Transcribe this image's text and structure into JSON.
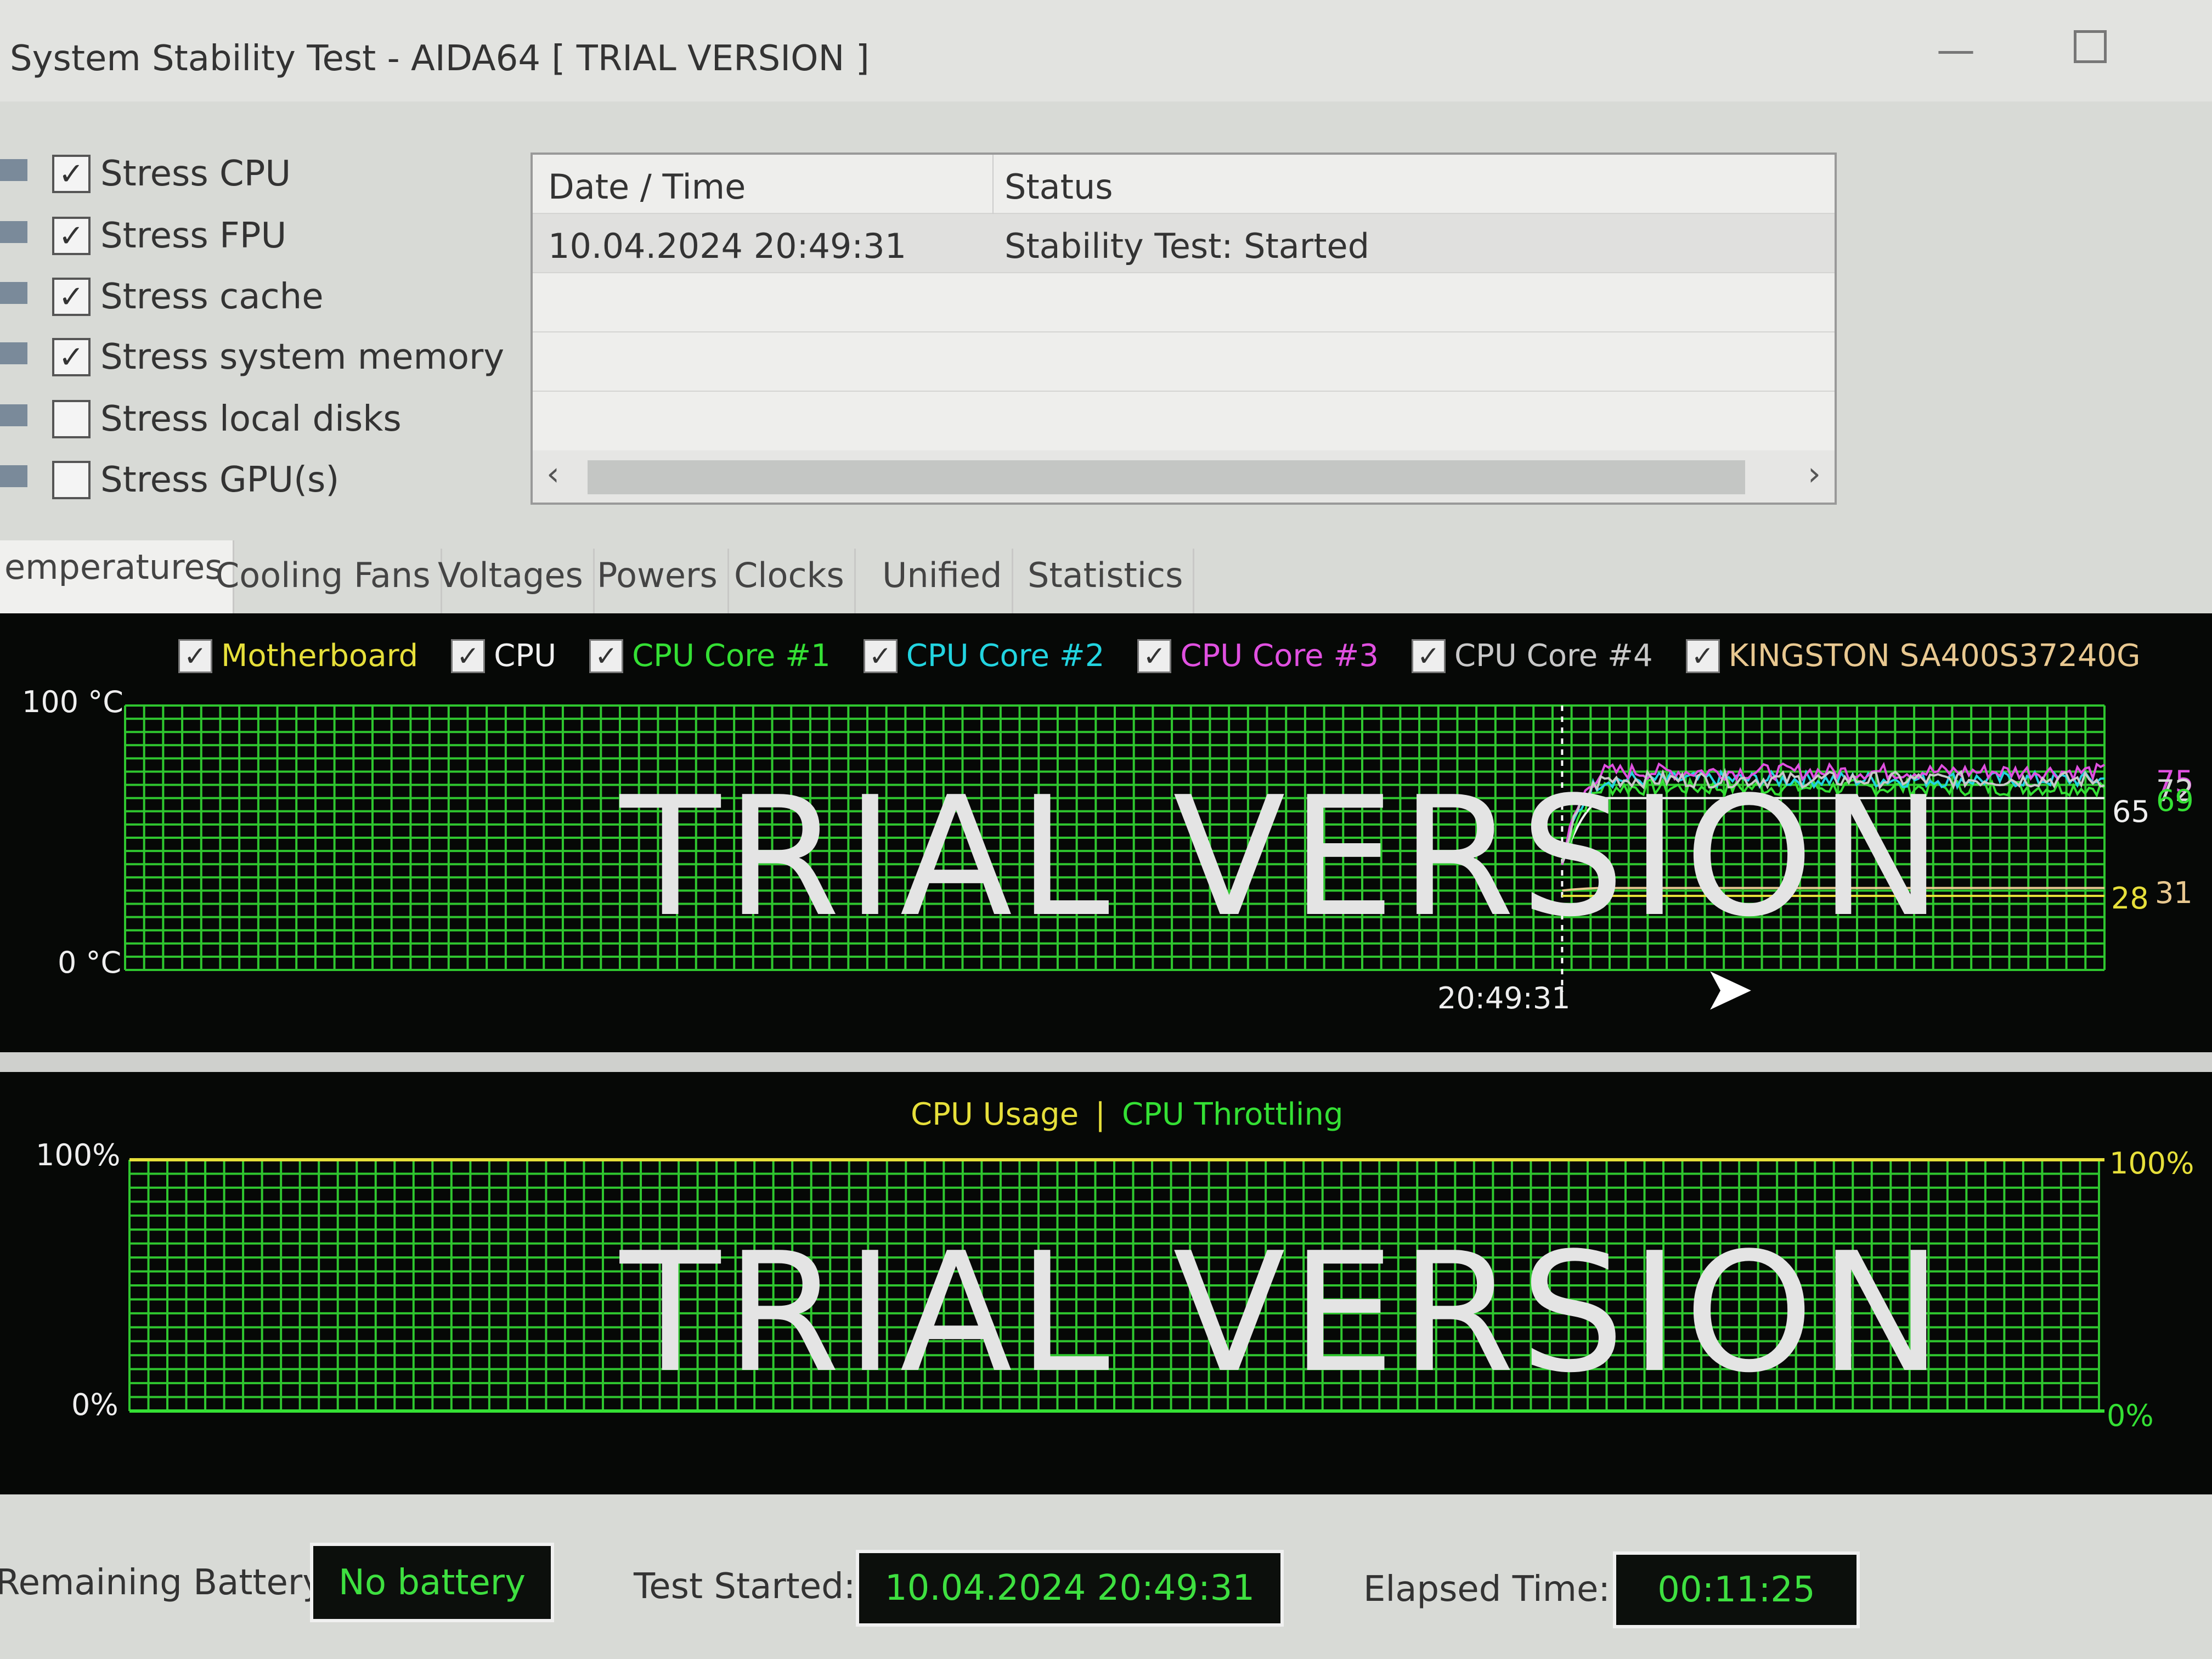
{
  "window": {
    "title": "System Stability Test - AIDA64  [ TRIAL VERSION ]",
    "minimize_icon": "minimize-icon",
    "maximize_icon": "maximize-icon"
  },
  "stress_options": [
    {
      "label": "Stress CPU",
      "checked": true
    },
    {
      "label": "Stress FPU",
      "checked": true
    },
    {
      "label": "Stress cache",
      "checked": true
    },
    {
      "label": "Stress system memory",
      "checked": true
    },
    {
      "label": "Stress local disks",
      "checked": false
    },
    {
      "label": "Stress GPU(s)",
      "checked": false
    }
  ],
  "log": {
    "columns": [
      "Date / Time",
      "Status"
    ],
    "rows": [
      {
        "datetime": "10.04.2024 20:49:31",
        "status": "Stability Test: Started"
      }
    ]
  },
  "tabs": [
    "emperatures",
    "Cooling Fans",
    "Voltages",
    "Powers",
    "Clocks",
    "Unified",
    "Statistics"
  ],
  "active_tab": "emperatures",
  "chart_data": [
    {
      "type": "line",
      "title": "",
      "ylabel": "",
      "ylim": [
        0,
        100
      ],
      "y_tick_labels": [
        "100 °C",
        "0 °C"
      ],
      "marker_label": "20:49:31",
      "watermark": "TRIAL VERSION",
      "grid": true,
      "legend_placement": "top",
      "series": [
        {
          "name": "Motherboard",
          "color": "#e6df3a",
          "checked": true,
          "current": 28,
          "start": 28
        },
        {
          "name": "CPU",
          "color": "#f0f0f0",
          "checked": true,
          "current": 65,
          "start": 40
        },
        {
          "name": "CPU Core #1",
          "color": "#34e034",
          "checked": true,
          "current": 69,
          "start": 42
        },
        {
          "name": "CPU Core #2",
          "color": "#22d4e0",
          "checked": true,
          "current": 72,
          "start": 42
        },
        {
          "name": "CPU Core #3",
          "color": "#e050e0",
          "checked": true,
          "current": 75,
          "start": 42
        },
        {
          "name": "CPU Core #4",
          "color": "#c8c8c8",
          "checked": true,
          "current": 72,
          "start": 42
        },
        {
          "name": "KINGSTON SA400S37240G",
          "color": "#e8c890",
          "checked": true,
          "current": 31,
          "start": 30
        }
      ],
      "current_labels": [
        "75",
        "72",
        "69",
        "65",
        "28",
        "31"
      ]
    },
    {
      "type": "line",
      "title": "",
      "ylim": [
        0,
        100
      ],
      "y_tick_labels_left": [
        "100%",
        "0%"
      ],
      "y_tick_labels_right": [
        "100%",
        "0%"
      ],
      "watermark": "TRIAL VERSION",
      "grid": true,
      "legend_placement": "top",
      "series": [
        {
          "name": "CPU Usage",
          "color": "#e6df3a",
          "current": 100
        },
        {
          "name": "CPU Throttling",
          "color": "#34e034",
          "current": 0
        }
      ],
      "separator": "|"
    }
  ],
  "status": {
    "battery_label": "Remaining Battery:",
    "battery_value": "No battery",
    "started_label": "Test Started:",
    "started_value": "10.04.2024 20:49:31",
    "elapsed_label": "Elapsed Time:",
    "elapsed_value": "00:11:25"
  }
}
